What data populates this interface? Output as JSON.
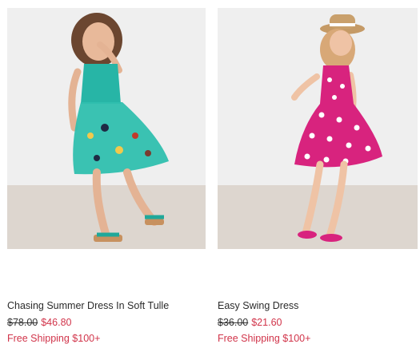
{
  "products": [
    {
      "name": "Chasing Summer Dress In Soft Tulle",
      "original_price": "$78.00",
      "sale_price": "$46.80",
      "shipping": "Free Shipping $100+",
      "image_alt": "Chasing Summer Dress In Soft Tulle",
      "dress_color": "#27b5a6"
    },
    {
      "name": "Easy Swing Dress",
      "original_price": "$36.00",
      "sale_price": "$21.60",
      "shipping": "Free Shipping $100+",
      "image_alt": "Easy Swing Dress",
      "dress_color": "#d8237e"
    }
  ],
  "colors": {
    "sale": "#d1344a",
    "text": "#2b2b2b"
  }
}
